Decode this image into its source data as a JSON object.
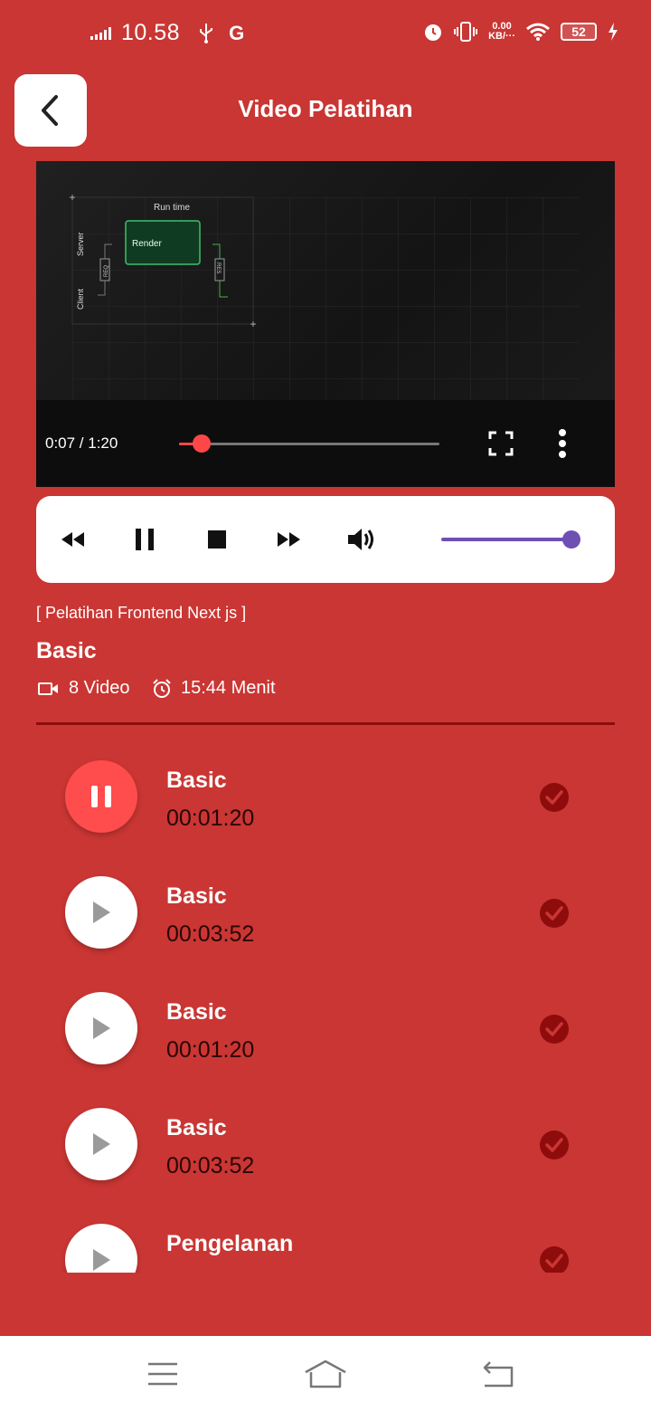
{
  "status_bar": {
    "time": "10.58",
    "carrier_letter": "G",
    "net_speed_value": "0.00",
    "net_speed_unit": "KB/···",
    "battery": "52"
  },
  "header": {
    "title": "Video Pelatihan",
    "back_icon": "chevron-left-icon"
  },
  "video": {
    "time_display": "0:07 / 1:20",
    "progress": 0.0875,
    "frame_texts": {
      "run_time": "Run time",
      "render": "Render",
      "server": "Server",
      "client": "Client",
      "req": "REQ",
      "res": "RES"
    }
  },
  "player_controls": {
    "icons": [
      "rewind-icon",
      "pause-icon",
      "stop-icon",
      "fast-forward-icon",
      "volume-icon"
    ],
    "volume_level": 1.0,
    "accent_color": "#6E4FB3"
  },
  "course": {
    "tag": "[ Pelatihan Frontend Next js ]",
    "title": "Basic",
    "video_count": "8 Video",
    "duration": "15:44 Menit"
  },
  "playlist": [
    {
      "title": "Basic",
      "duration": "00:01:20",
      "state": "playing",
      "completed": true
    },
    {
      "title": "Basic",
      "duration": "00:03:52",
      "state": "idle",
      "completed": true
    },
    {
      "title": "Basic",
      "duration": "00:01:20",
      "state": "idle",
      "completed": true
    },
    {
      "title": "Basic",
      "duration": "00:03:52",
      "state": "idle",
      "completed": true
    },
    {
      "title": "Pengelanan",
      "duration": "",
      "state": "idle",
      "completed": true
    }
  ],
  "colors": {
    "background": "#C93633",
    "active_play": "#FF4C4C",
    "check": "#8E0C0C",
    "divider": "#8E0C0C"
  },
  "navbar": {
    "icons": [
      "menu-icon",
      "home-icon",
      "back-icon"
    ]
  }
}
